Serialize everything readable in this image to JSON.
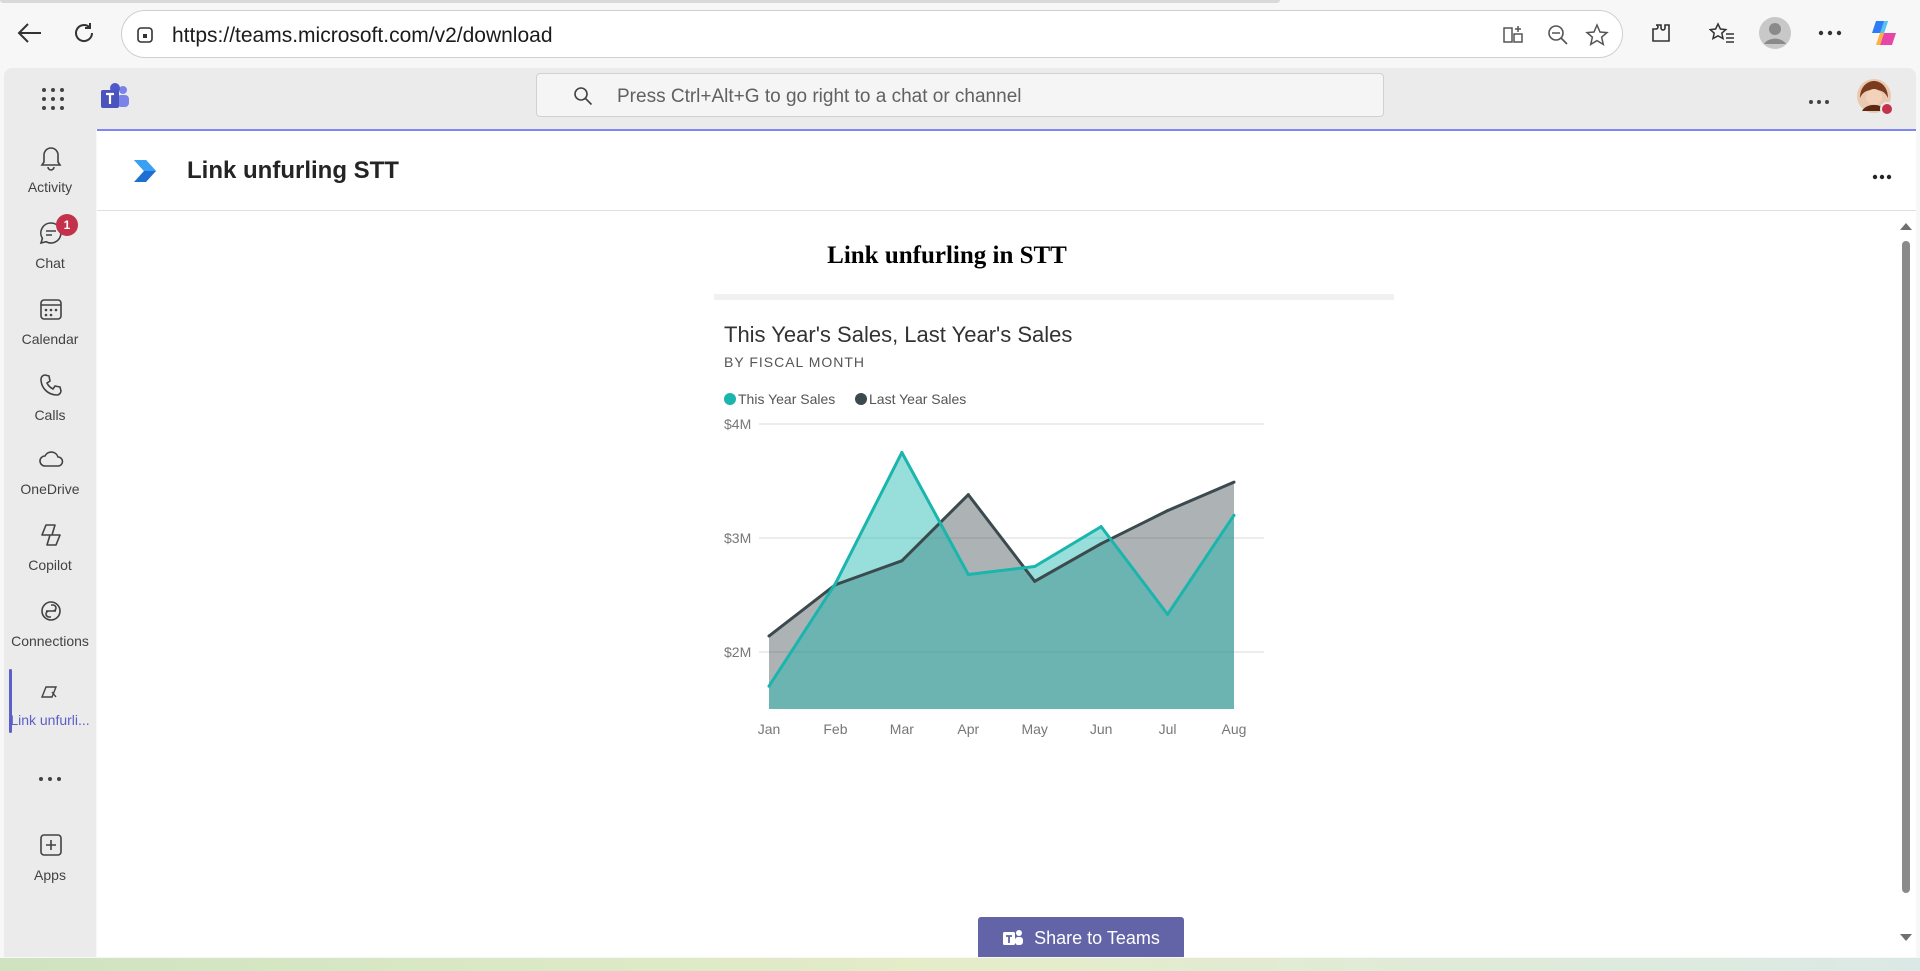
{
  "browser": {
    "url": "https://teams.microsoft.com/v2/download"
  },
  "teams": {
    "search_placeholder": "Press Ctrl+Alt+G to go right to a chat or channel"
  },
  "rail": {
    "items": [
      {
        "label": "Activity",
        "icon": "bell-icon"
      },
      {
        "label": "Chat",
        "icon": "chat-icon",
        "badge": "1"
      },
      {
        "label": "Calendar",
        "icon": "calendar-icon"
      },
      {
        "label": "Calls",
        "icon": "phone-icon"
      },
      {
        "label": "OneDrive",
        "icon": "cloud-icon"
      },
      {
        "label": "Copilot",
        "icon": "copilot-icon"
      },
      {
        "label": "Connections",
        "icon": "connections-icon"
      },
      {
        "label": "Link unfurli...",
        "icon": "link-unfurling-app-icon"
      },
      {
        "label": "Apps",
        "icon": "plus-square-icon"
      }
    ]
  },
  "app": {
    "title": "Link unfurling STT",
    "heading": "Link unfurling in STT",
    "share_label": "Share to Teams"
  },
  "chart_data": {
    "type": "area",
    "title": "This Year's Sales, Last Year's Sales",
    "subtitle": "BY FISCAL MONTH",
    "categories": [
      "Jan",
      "Feb",
      "Mar",
      "Apr",
      "May",
      "Jun",
      "Jul",
      "Aug"
    ],
    "series": [
      {
        "name": "This Year Sales",
        "color": "#1ab5ac",
        "values": [
          1.7,
          2.6,
          3.75,
          2.68,
          2.75,
          3.1,
          2.33,
          3.2
        ]
      },
      {
        "name": "Last Year Sales",
        "color": "#3b4a4f",
        "values": [
          2.14,
          2.59,
          2.8,
          3.38,
          2.62,
          2.95,
          3.24,
          3.49
        ]
      }
    ],
    "yticks": [
      "$4M",
      "$3M",
      "$2M"
    ],
    "ylim": [
      1.5,
      4.0
    ],
    "legend": "top-left",
    "grid": true
  }
}
